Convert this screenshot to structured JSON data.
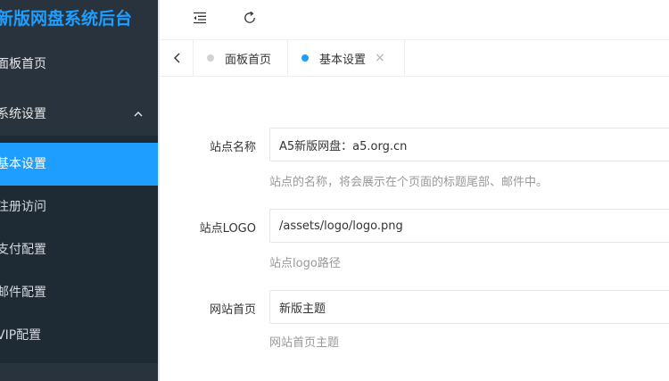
{
  "sidebar": {
    "title": "新版网盘系统后台",
    "home": "面板首页",
    "group": "系统设置",
    "items": [
      {
        "label": "基本设置"
      },
      {
        "label": "注册访问"
      },
      {
        "label": "支付配置"
      },
      {
        "label": "邮件配置"
      },
      {
        "label": "VIP配置"
      }
    ]
  },
  "header": {
    "collapse_icon": "indent-collapse-icon",
    "refresh_icon": "refresh-icon"
  },
  "tabs": {
    "prev_icon": "chevron-left-icon",
    "items": [
      {
        "label": "面板首页"
      },
      {
        "label": "基本设置",
        "close": "×"
      }
    ]
  },
  "form": {
    "site_name": {
      "label": "站点名称",
      "value": "A5新版网盘：a5.org.cn",
      "hint": "站点的名称，将会展示在个页面的标题尾部、邮件中。"
    },
    "site_logo": {
      "label": "站点LOGO",
      "value": "/assets/logo/logo.png",
      "hint": "站点logo路径"
    },
    "site_home": {
      "label": "网站首页",
      "value": "新版主题",
      "hint": "网站首页主题"
    }
  },
  "colors": {
    "accent": "#1e9fff",
    "sidebar_bg": "#28333e",
    "submenu_bg": "#1e2a34"
  }
}
